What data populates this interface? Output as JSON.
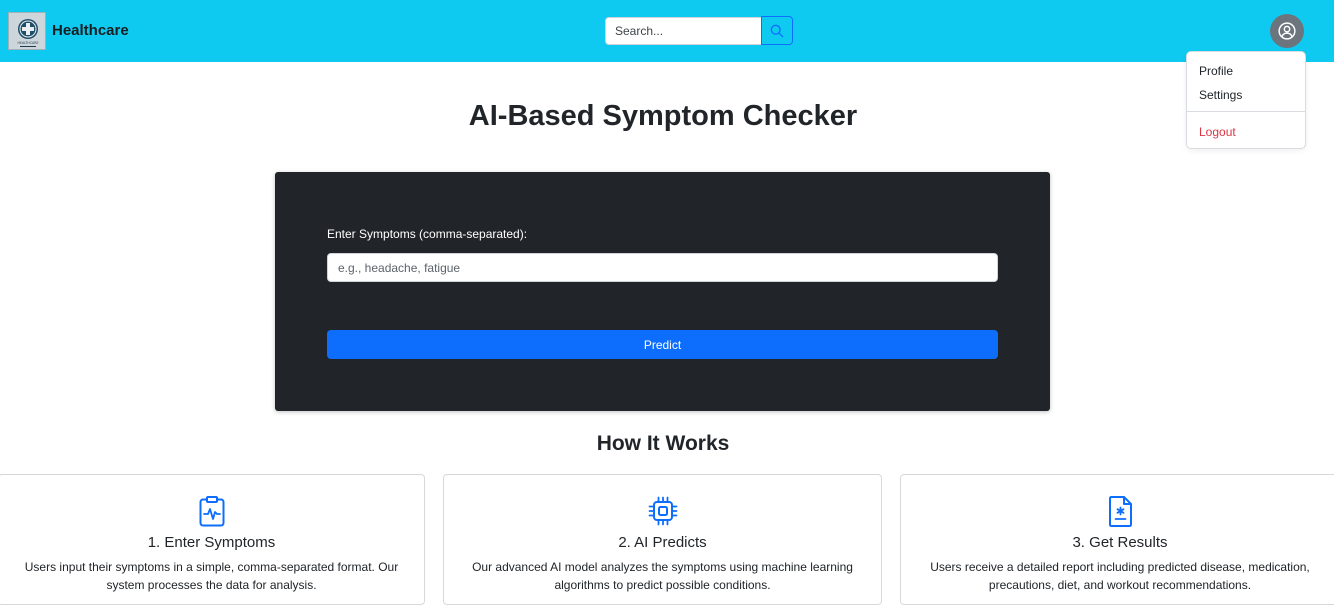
{
  "navbar": {
    "brand_name": "Healthcare",
    "logo_text": "HEALTHCARE",
    "search": {
      "placeholder": "Search..."
    },
    "colors": {
      "background": "#0fcaf0",
      "search_button_border": "#0d6efd",
      "avatar": "#6c757d"
    },
    "icons": {
      "logo": "medical-cross-logo",
      "search": "search-icon",
      "user": "user-circle-icon"
    }
  },
  "dropdown": {
    "items": [
      {
        "label": "Profile"
      },
      {
        "label": "Settings"
      },
      {
        "label": "Logout",
        "color": "#dc3545"
      }
    ]
  },
  "page": {
    "title": "AI-Based Symptom Checker"
  },
  "form": {
    "label": "Enter Symptoms (comma-separated):",
    "input_placeholder": "e.g., headache, fatigue",
    "input_value": "",
    "button_label": "Predict",
    "colors": {
      "card_background": "#212529",
      "button": "#0d6efd"
    }
  },
  "how_it_works": {
    "title": "How It Works",
    "steps": [
      {
        "icon": "clipboard-pulse-icon",
        "title": "1. Enter Symptoms",
        "description": "Users input their symptoms in a simple, comma-separated format. Our system processes the data for analysis."
      },
      {
        "icon": "cpu-chip-icon",
        "title": "2. AI Predicts",
        "description": "Our advanced AI model analyzes the symptoms using machine learning algorithms to predict possible conditions."
      },
      {
        "icon": "file-medical-icon",
        "title": "3. Get Results",
        "description": "Users receive a detailed report including predicted disease, medication, precautions, diet, and workout recommendations."
      }
    ],
    "icon_color": "#0d6efd"
  }
}
